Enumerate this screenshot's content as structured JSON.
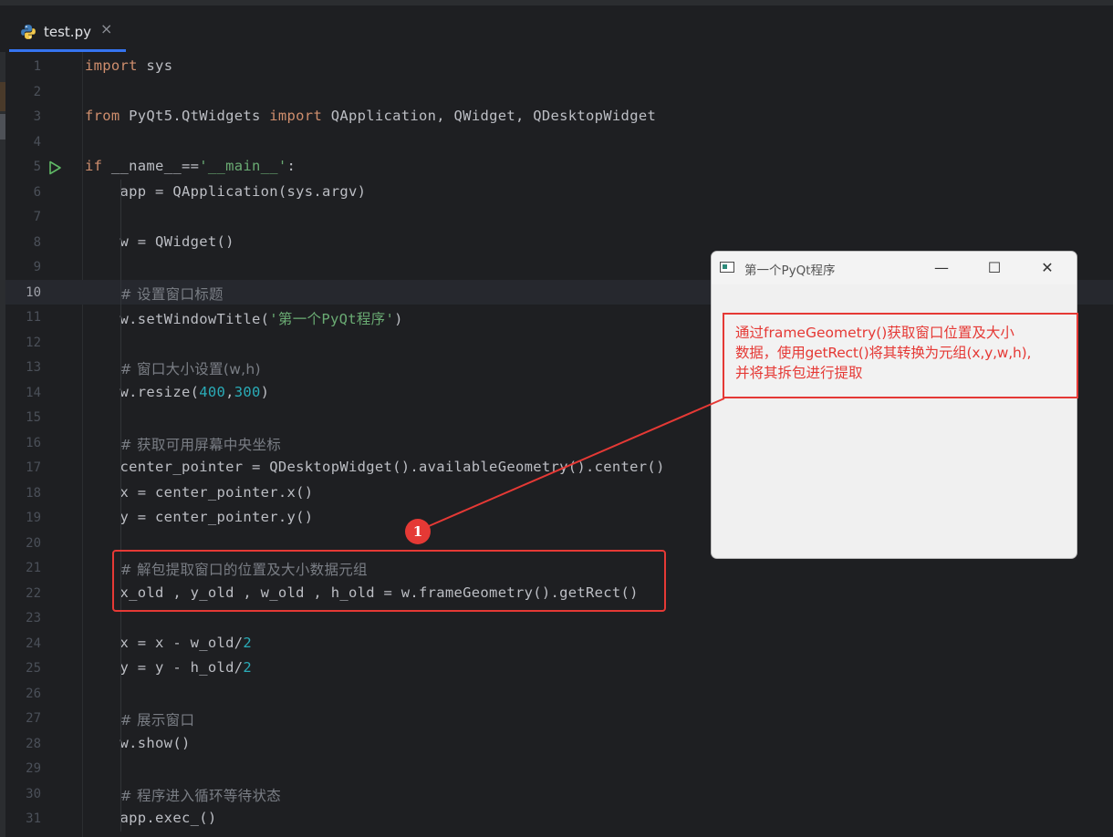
{
  "tab": {
    "label": "test.py",
    "close": "×",
    "icon": "python-file-icon"
  },
  "gutter": {
    "run_icon": "run-play-icon",
    "current_line": 10
  },
  "lines": [
    {
      "n": "1",
      "s": [
        {
          "t": "kw",
          "v": "import"
        },
        {
          "t": "p",
          "v": " sys"
        }
      ]
    },
    {
      "n": "2",
      "s": []
    },
    {
      "n": "3",
      "s": [
        {
          "t": "kw",
          "v": "from"
        },
        {
          "t": "p",
          "v": " PyQt5.QtWidgets "
        },
        {
          "t": "kw",
          "v": "import"
        },
        {
          "t": "p",
          "v": " QApplication, QWidget, QDesktopWidget"
        }
      ]
    },
    {
      "n": "4",
      "s": []
    },
    {
      "n": "5",
      "s": [
        {
          "t": "kw",
          "v": "if"
        },
        {
          "t": "p",
          "v": " __name__=="
        },
        {
          "t": "str",
          "v": "'__main__'"
        },
        {
          "t": "p",
          "v": ":"
        }
      ],
      "run": true
    },
    {
      "n": "6",
      "s": [
        {
          "t": "p",
          "v": "    app = QApplication(sys.argv)"
        }
      ]
    },
    {
      "n": "7",
      "s": []
    },
    {
      "n": "8",
      "s": [
        {
          "t": "p",
          "v": "    w = QWidget()"
        }
      ]
    },
    {
      "n": "9",
      "s": []
    },
    {
      "n": "10",
      "s": [
        {
          "t": "p",
          "v": "    "
        },
        {
          "t": "cm",
          "v": "# 设置窗口标题"
        }
      ]
    },
    {
      "n": "11",
      "s": [
        {
          "t": "p",
          "v": "    w.setWindowTitle("
        },
        {
          "t": "str",
          "v": "'第一个PyQt程序'"
        },
        {
          "t": "p",
          "v": ")"
        }
      ]
    },
    {
      "n": "12",
      "s": []
    },
    {
      "n": "13",
      "s": [
        {
          "t": "p",
          "v": "    "
        },
        {
          "t": "cm",
          "v": "# 窗口大小设置(w,h)"
        }
      ]
    },
    {
      "n": "14",
      "s": [
        {
          "t": "p",
          "v": "    w.resize("
        },
        {
          "t": "num",
          "v": "400"
        },
        {
          "t": "p",
          "v": ","
        },
        {
          "t": "num",
          "v": "300"
        },
        {
          "t": "p",
          "v": ")"
        }
      ]
    },
    {
      "n": "15",
      "s": []
    },
    {
      "n": "16",
      "s": [
        {
          "t": "p",
          "v": "    "
        },
        {
          "t": "cm",
          "v": "# 获取可用屏幕中央坐标"
        }
      ]
    },
    {
      "n": "17",
      "s": [
        {
          "t": "p",
          "v": "    center_pointer = QDesktopWidget().availableGeometry().center()"
        }
      ]
    },
    {
      "n": "18",
      "s": [
        {
          "t": "p",
          "v": "    x = center_pointer.x()"
        }
      ]
    },
    {
      "n": "19",
      "s": [
        {
          "t": "p",
          "v": "    y = center_pointer.y()"
        }
      ]
    },
    {
      "n": "20",
      "s": []
    },
    {
      "n": "21",
      "s": [
        {
          "t": "p",
          "v": "    "
        },
        {
          "t": "cm",
          "v": "# 解包提取窗口的位置及大小数据元组"
        }
      ]
    },
    {
      "n": "22",
      "s": [
        {
          "t": "p",
          "v": "    x_old , y_old , w_old , h_old = w.frameGeometry().getRect()"
        }
      ]
    },
    {
      "n": "23",
      "s": []
    },
    {
      "n": "24",
      "s": [
        {
          "t": "p",
          "v": "    x = x - w_old/"
        },
        {
          "t": "num",
          "v": "2"
        }
      ]
    },
    {
      "n": "25",
      "s": [
        {
          "t": "p",
          "v": "    y = y - h_old/"
        },
        {
          "t": "num",
          "v": "2"
        }
      ]
    },
    {
      "n": "26",
      "s": []
    },
    {
      "n": "27",
      "s": [
        {
          "t": "p",
          "v": "    "
        },
        {
          "t": "cm",
          "v": "# 展示窗口"
        }
      ]
    },
    {
      "n": "28",
      "s": [
        {
          "t": "p",
          "v": "    w.show()"
        }
      ]
    },
    {
      "n": "29",
      "s": []
    },
    {
      "n": "30",
      "s": [
        {
          "t": "p",
          "v": "    "
        },
        {
          "t": "cm",
          "v": "# 程序进入循环等待状态"
        }
      ]
    },
    {
      "n": "31",
      "s": [
        {
          "t": "p",
          "v": "    app.exec_()"
        }
      ]
    }
  ],
  "qt_window": {
    "title": "第一个PyQt程序",
    "minimize": "—",
    "maximize": "☐",
    "close": "✕",
    "app_icon": "window-app-icon"
  },
  "annotation": {
    "line1": "通过frameGeometry()获取窗口位置及大小",
    "line2": "数据，使用getRect()将其转换为元组(x,y,w,h),",
    "line3": "并将其拆包进行提取",
    "badge": "1"
  },
  "colors": {
    "accent": "#e53935",
    "keyword": "#cf8e6d",
    "string": "#6aab73",
    "number": "#2aacb8",
    "comment": "#7a7e85",
    "text": "#bcbec4"
  }
}
